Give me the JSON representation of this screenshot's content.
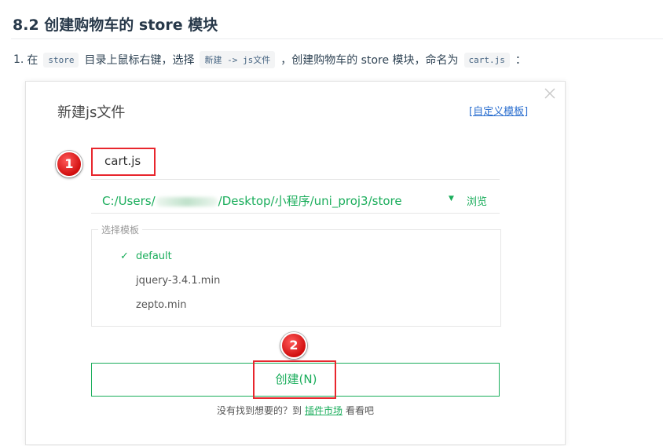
{
  "heading": "8.2 创建购物车的 store 模块",
  "step": {
    "number": "1.",
    "t1": "在",
    "code1": "store",
    "t2": "目录上鼠标右键，选择",
    "code2": "新建 -> js文件",
    "t3": "，创建购物车的 store 模块，命名为",
    "code3": "cart.js",
    "t4": "："
  },
  "dialog": {
    "title": "新建js文件",
    "custom_template": "[自定义模板]",
    "filename": "cart.js",
    "path_prefix": "C:/Users/",
    "path_suffix": "/Desktop/小程序/uni_proj3/store",
    "browse": "浏览",
    "template_legend": "选择模板",
    "templates": [
      "default",
      "jquery-3.4.1.min",
      "zepto.min"
    ],
    "selected_template": "default",
    "create_button": "创建(N)",
    "footer_prefix": "没有找到想要的？到",
    "footer_link": "插件市场",
    "footer_suffix": "看看吧"
  },
  "markers": [
    "1",
    "2"
  ],
  "colors": {
    "accent_green": "#1aad5b",
    "highlight_red": "#e8262d",
    "link_blue": "#2a6ecf"
  }
}
